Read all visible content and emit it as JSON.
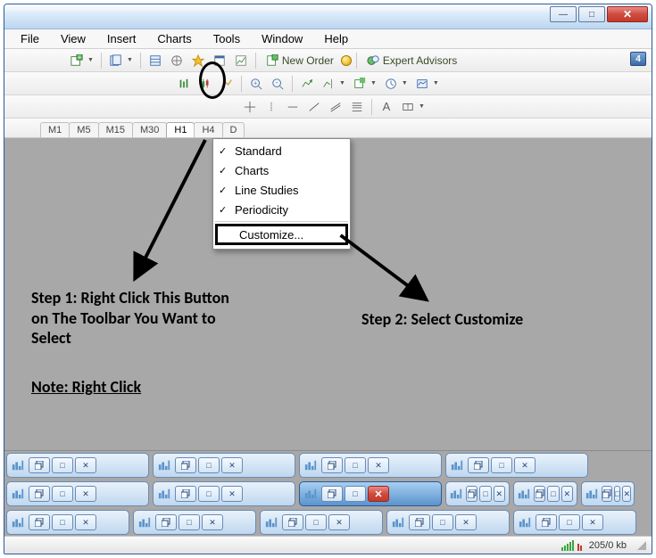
{
  "menu": {
    "items": [
      "File",
      "View",
      "Insert",
      "Charts",
      "Tools",
      "Window",
      "Help"
    ]
  },
  "toolbar1": {
    "new_order_label": "New Order",
    "expert_advisors_label": "Expert Advisors",
    "badge": "4"
  },
  "timeframes": {
    "items": [
      "M1",
      "M5",
      "M15",
      "M30",
      "H1",
      "H4",
      "D"
    ],
    "selected": "H1"
  },
  "context_menu": {
    "items": [
      {
        "label": "Standard",
        "checked": true
      },
      {
        "label": "Charts",
        "checked": true
      },
      {
        "label": "Line Studies",
        "checked": true
      },
      {
        "label": "Periodicity",
        "checked": true
      }
    ],
    "customize_label": "Customize..."
  },
  "annotations": {
    "step1": "Step 1: Right Click This Button on The Toolbar You Want to Select",
    "step2": "Step 2: Select Customize",
    "note": "Note: Right Click"
  },
  "status": {
    "kb": "205/0 kb"
  },
  "window_controls": {
    "min": "—",
    "max": "□",
    "close": "✕"
  },
  "colors": {
    "accent": "#3a6aa8",
    "close_red": "#c33a2c",
    "workspace_bg": "#a8a8a8"
  }
}
